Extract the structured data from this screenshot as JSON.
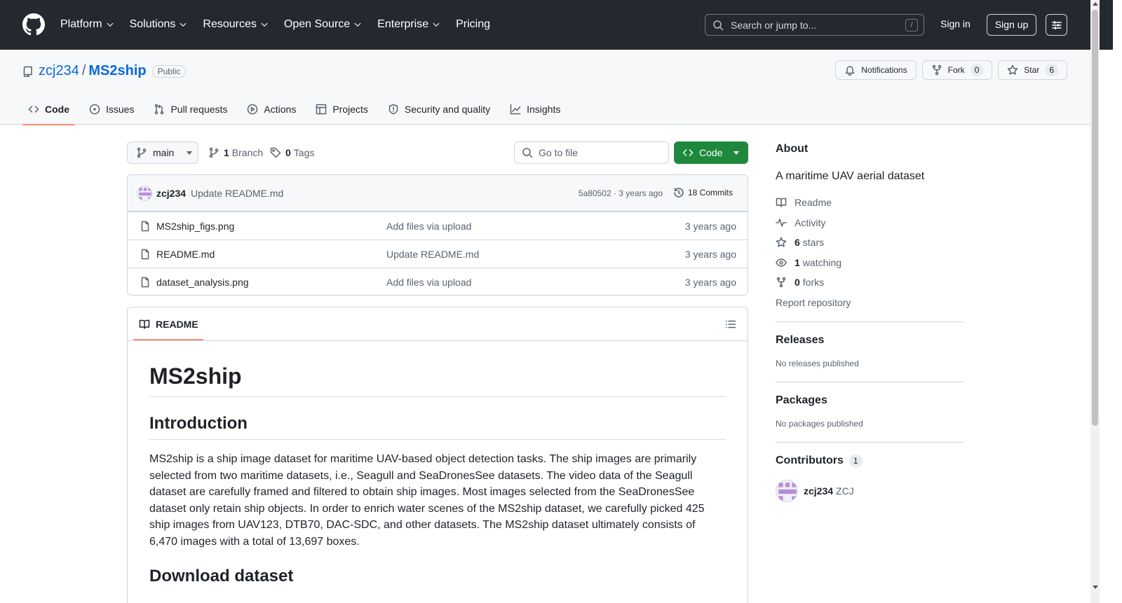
{
  "header": {
    "nav": [
      {
        "label": "Platform",
        "has_menu": true
      },
      {
        "label": "Solutions",
        "has_menu": true
      },
      {
        "label": "Resources",
        "has_menu": true
      },
      {
        "label": "Open Source",
        "has_menu": true
      },
      {
        "label": "Enterprise",
        "has_menu": true
      },
      {
        "label": "Pricing",
        "has_menu": false
      }
    ],
    "search_placeholder": "Search or jump to...",
    "search_shortcut": "/",
    "signin": "Sign in",
    "signup": "Sign up"
  },
  "repo": {
    "owner": "zcj234",
    "separator": "/",
    "name": "MS2ship",
    "visibility": "Public",
    "notifications_label": "Notifications",
    "fork_label": "Fork",
    "fork_count": "0",
    "star_label": "Star",
    "star_count": "6"
  },
  "tabs": [
    {
      "label": "Code",
      "icon": "code-icon",
      "active": true
    },
    {
      "label": "Issues",
      "icon": "issue-icon"
    },
    {
      "label": "Pull requests",
      "icon": "pull-request-icon"
    },
    {
      "label": "Actions",
      "icon": "play-icon"
    },
    {
      "label": "Projects",
      "icon": "table-icon"
    },
    {
      "label": "Security and quality",
      "icon": "shield-icon"
    },
    {
      "label": "Insights",
      "icon": "graph-icon"
    }
  ],
  "toolbar": {
    "branch": "main",
    "branch_count": "1",
    "branch_label": "Branch",
    "tag_count": "0",
    "tag_label": "Tags",
    "goto_placeholder": "Go to file",
    "code_label": "Code"
  },
  "commit": {
    "user": "zcj234",
    "message": "Update README.md",
    "hash_age": "5a80502 · 3 years ago",
    "commits": "18 Commits"
  },
  "files": [
    {
      "name": "MS2ship_figs.png",
      "message": "Add files via upload",
      "age": "3 years ago"
    },
    {
      "name": "README.md",
      "message": "Update README.md",
      "age": "3 years ago"
    },
    {
      "name": "dataset_analysis.png",
      "message": "Add files via upload",
      "age": "3 years ago"
    }
  ],
  "readme": {
    "tab_label": "README",
    "title": "MS2ship",
    "intro_heading": "Introduction",
    "intro_text": "MS2ship is a ship image dataset for maritime UAV-based object detection tasks. The ship images are primarily selected from two maritime datasets, i.e., Seagull and SeaDronesSee datasets. The video data of the Seagull dataset are carefully framed and filtered to obtain ship images. Most images selected from the SeaDronesSee dataset only retain ship objects. In order to enrich water scenes of the MS2ship dataset, we carefully picked 425 ship images from UAV123, DTB70, DAC-SDC, and other datasets. The MS2ship dataset ultimately consists of 6,470 images with a total of 13,697 boxes.",
    "download_heading": "Download dataset"
  },
  "sidebar": {
    "about_heading": "About",
    "description": "A maritime UAV aerial dataset",
    "readme_link": "Readme",
    "activity_link": "Activity",
    "stars_count": "6",
    "stars_label": "stars",
    "watching_count": "1",
    "watching_label": "watching",
    "forks_count": "0",
    "forks_label": "forks",
    "report": "Report repository",
    "releases_heading": "Releases",
    "releases_text": "No releases published",
    "packages_heading": "Packages",
    "packages_text": "No packages published",
    "contributors_heading": "Contributors",
    "contributors_count": "1",
    "contributor_user": "zcj234",
    "contributor_name": "ZCJ"
  },
  "colors": {
    "header_bg": "#24292f",
    "link": "#0969da",
    "primary_button": "#1f883d",
    "active_tab_underline": "#fd8c73"
  }
}
